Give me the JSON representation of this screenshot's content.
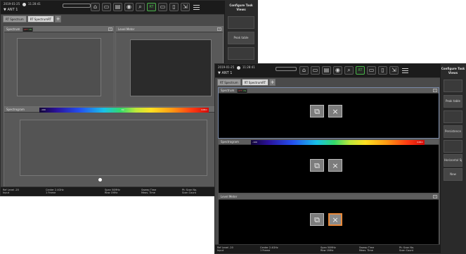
{
  "status": {
    "date": "2019-01-25",
    "time": "11:28:41",
    "antenna": "ANT 1"
  },
  "toolbar": {
    "icons": [
      "home-icon",
      "folder-open-icon",
      "folder-save-icon",
      "camera-icon",
      "search-icon",
      "mode-icon",
      "monitor-icon",
      "window-icon",
      "export-icon",
      "menu-icon"
    ]
  },
  "tabs": {
    "spectrum": "RT Spectrum",
    "spectrum_rt": "RT SpectrumRT",
    "add": "+"
  },
  "panel": {
    "title": "Configure Task Views",
    "btn_peak": "Peak table",
    "btn_persist": "Persistence",
    "btn_horizontal": "Horizontal Sp",
    "btn_new": "New"
  },
  "panes": {
    "spectrum": "Spectrum",
    "badge_red": "OFF",
    "badge_green": "ON",
    "spectrogram": "Spectrogram",
    "grad_left": "-100",
    "grad_right": "0dBm",
    "grad_mid": "-50",
    "level_meter": "Level Meter"
  },
  "info": {
    "ref": "Ref Level -20",
    "ref_val": "Input",
    "center": "Center 2.4GHz",
    "center_val": "1 Frame",
    "span": "Span 50MHz",
    "span_val": "Rbw 1MHz",
    "sweep": "Sweep Time",
    "sweep_val": "Meas. Time",
    "pt": "Pt: Scan No.",
    "pt_val": "Scan Count"
  },
  "colors": {
    "accent": "#49b649",
    "select": "#e8893b"
  }
}
